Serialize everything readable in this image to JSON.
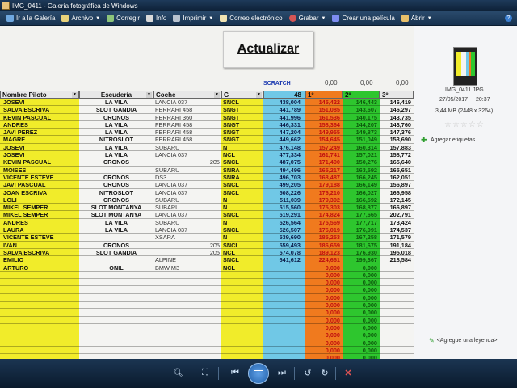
{
  "window": {
    "title": "IMG_0411 - Galería fotográfica de Windows"
  },
  "toolbar": {
    "items": [
      {
        "label": "Ir a la Galería",
        "icon": "back-icon",
        "dropdown": false
      },
      {
        "label": "Archivo",
        "icon": "file-icon",
        "dropdown": true
      },
      {
        "label": "Corregir",
        "icon": "fix-icon",
        "dropdown": false
      },
      {
        "label": "Info",
        "icon": "info-icon",
        "dropdown": false
      },
      {
        "label": "Imprimir",
        "icon": "print-icon",
        "dropdown": true
      },
      {
        "label": "Correo electrónico",
        "icon": "email-icon",
        "dropdown": false
      },
      {
        "label": "Grabar",
        "icon": "burn-icon",
        "dropdown": true
      },
      {
        "label": "Crear una película",
        "icon": "movie-icon",
        "dropdown": false
      },
      {
        "label": "Abrir",
        "icon": "open-icon",
        "dropdown": true
      }
    ]
  },
  "photo": {
    "button_label": "Actualizar",
    "scratch_label": "SCRATCH",
    "top_values": [
      "0,00",
      "0,00",
      "0,00"
    ],
    "headers": {
      "name": "Nombre Piloto",
      "team": "Escudería",
      "car": "Coche",
      "group": "G",
      "score": "48",
      "r1": "1º",
      "r2": "2º",
      "r3": "3º"
    },
    "rows": [
      {
        "name": "JOSEVI",
        "team": "LA VILA",
        "car": "LANCIA 037",
        "g": "SNCL",
        "score": "438,004",
        "r1": "145,422",
        "r2": "146,443",
        "r3": "146,419"
      },
      {
        "name": "SALVA ESCRIVA",
        "team": "SLOT GANDIA",
        "car": "FERRARI 458",
        "g": "SNGT",
        "score": "441,789",
        "r1": "151,085",
        "r2": "143,607",
        "r3": "146,297"
      },
      {
        "name": "KEVIN PASCUAL",
        "team": "CRONOS",
        "car": "FERRARI 360",
        "g": "SNGT",
        "score": "441,996",
        "r1": "161,536",
        "r2": "140,175",
        "r3": "143,735"
      },
      {
        "name": "ANDRES",
        "team": "LA VILA",
        "car": "FERRARI 458",
        "g": "SNGT",
        "score": "446,331",
        "r1": "158,364",
        "r2": "144,207",
        "r3": "143,760"
      },
      {
        "name": "JAVI PEREZ",
        "team": "LA VILA",
        "car": "FERRARI 458",
        "g": "SNGT",
        "score": "447,204",
        "r1": "149,955",
        "r2": "149,873",
        "r3": "147,376"
      },
      {
        "name": "MAGRE",
        "team": "NITROSLOT",
        "car": "FERRARI 458",
        "g": "SNGT",
        "score": "449,662",
        "r1": "154,645",
        "r2": "151,049",
        "r3": "153,690"
      },
      {
        "name": "JOSEVI",
        "team": "LA VILA",
        "car": "SUBARU",
        "g": "N",
        "score": "476,148",
        "r1": "157,249",
        "r2": "160,314",
        "r3": "157,883"
      },
      {
        "name": "JOSEVI",
        "team": "LA VILA",
        "car": "LANCIA 037",
        "g": "NCL",
        "score": "477,334",
        "r1": "161,741",
        "r2": "157,021",
        "r3": "158,772"
      },
      {
        "name": "KEVIN PASCUAL",
        "team": "CRONOS",
        "car": "205",
        "g": "SNCL",
        "score": "487,075",
        "r1": "171,400",
        "r2": "150,276",
        "r3": "165,640"
      },
      {
        "name": "MOISES",
        "team": "",
        "car": "SUBARU",
        "g": "SNRA",
        "score": "494,496",
        "r1": "165,217",
        "r2": "163,592",
        "r3": "165,651"
      },
      {
        "name": "VICENTE ESTEVE",
        "team": "CRONOS",
        "car": "DS3",
        "g": "SNRA",
        "score": "496,703",
        "r1": "168,487",
        "r2": "166,245",
        "r3": "162,051"
      },
      {
        "name": "JAVI PASCUAL",
        "team": "CRONOS",
        "car": "LANCIA 037",
        "g": "SNCL",
        "score": "499,205",
        "r1": "179,188",
        "r2": "166,149",
        "r3": "156,897"
      },
      {
        "name": "JOAN ESCRIVA",
        "team": "NITROSLOT",
        "car": "LANCIA 037",
        "g": "SNCL",
        "score": "508,226",
        "r1": "176,210",
        "r2": "166,027",
        "r3": "166,958"
      },
      {
        "name": "LOLI",
        "team": "CRONOS",
        "car": "SUBARU",
        "g": "N",
        "score": "511,039",
        "r1": "179,302",
        "r2": "166,592",
        "r3": "172,145"
      },
      {
        "name": "MIKEL SEMPER",
        "team": "SLOT MONTANYA",
        "car": "SUBARU",
        "g": "N",
        "score": "515,560",
        "r1": "175,303",
        "r2": "168,877",
        "r3": "166,897"
      },
      {
        "name": "MIKEL SEMPER",
        "team": "SLOT MONTANYA",
        "car": "LANCIA 037",
        "g": "SNCL",
        "score": "519,291",
        "r1": "174,824",
        "r2": "177,665",
        "r3": "202,791"
      },
      {
        "name": "ANDRES",
        "team": "LA VILA",
        "car": "SUBARU",
        "g": "N",
        "score": "526,564",
        "r1": "175,569",
        "r2": "177,717",
        "r3": "173,424"
      },
      {
        "name": "LAURA",
        "team": "LA VILA",
        "car": "LANCIA 037",
        "g": "SNCL",
        "score": "526,507",
        "r1": "176,019",
        "r2": "176,091",
        "r3": "174,537"
      },
      {
        "name": "VICENTE ESTEVE",
        "team": "",
        "car": "XSARA",
        "g": "N",
        "score": "539,690",
        "r1": "185,253",
        "r2": "167,258",
        "r3": "171,579"
      },
      {
        "name": "IVAN",
        "team": "CRONOS",
        "car": "205",
        "g": "SNCL",
        "score": "559,493",
        "r1": "186,659",
        "r2": "181,675",
        "r3": "191,184"
      },
      {
        "name": "SALVA ESCRIVA",
        "team": "SLOT GANDIA",
        "car": "205",
        "g": "NCL",
        "score": "574,078",
        "r1": "189,123",
        "r2": "176,930",
        "r3": "195,018"
      },
      {
        "name": "EMILIO",
        "team": "",
        "car": "ALPINE",
        "g": "SNCL",
        "score": "641,612",
        "r1": "224,661",
        "r2": "199,367",
        "r3": "218,584"
      },
      {
        "name": "ARTURO",
        "team": "ONIL",
        "car": "BMW M3",
        "g": "NCL",
        "score": "",
        "r1": "0,000",
        "r2": "0,000",
        "r3": ""
      },
      {
        "name": "",
        "team": "",
        "car": "",
        "g": "",
        "score": "",
        "r1": "0,000",
        "r2": "0,000",
        "r3": ""
      },
      {
        "name": "",
        "team": "",
        "car": "",
        "g": "",
        "score": "",
        "r1": "0,000",
        "r2": "0,000",
        "r3": ""
      },
      {
        "name": "",
        "team": "",
        "car": "",
        "g": "",
        "score": "",
        "r1": "0,000",
        "r2": "0,000",
        "r3": ""
      },
      {
        "name": "",
        "team": "",
        "car": "",
        "g": "",
        "score": "",
        "r1": "0,000",
        "r2": "0,000",
        "r3": ""
      },
      {
        "name": "",
        "team": "",
        "car": "",
        "g": "",
        "score": "",
        "r1": "0,000",
        "r2": "0,000",
        "r3": ""
      },
      {
        "name": "",
        "team": "",
        "car": "",
        "g": "",
        "score": "",
        "r1": "0,000",
        "r2": "0,000",
        "r3": ""
      },
      {
        "name": "",
        "team": "",
        "car": "",
        "g": "",
        "score": "",
        "r1": "0,000",
        "r2": "0,000",
        "r3": ""
      },
      {
        "name": "",
        "team": "",
        "car": "",
        "g": "",
        "score": "",
        "r1": "0,000",
        "r2": "0,000",
        "r3": ""
      },
      {
        "name": "",
        "team": "",
        "car": "",
        "g": "",
        "score": "",
        "r1": "0,000",
        "r2": "0,000",
        "r3": ""
      },
      {
        "name": "",
        "team": "",
        "car": "",
        "g": "",
        "score": "",
        "r1": "0,000",
        "r2": "0,000",
        "r3": ""
      },
      {
        "name": "",
        "team": "",
        "car": "",
        "g": "",
        "score": "",
        "r1": "0,000",
        "r2": "0,000",
        "r3": ""
      },
      {
        "name": "",
        "team": "",
        "car": "",
        "g": "",
        "score": "",
        "r1": "0,000",
        "r2": "0,000",
        "r3": ""
      }
    ]
  },
  "info_pane": {
    "filename": "IMG_0411.JPG",
    "date": "27/05/2017",
    "time": "20:37",
    "size": "3,44 MB (2448 x 3264)",
    "rating_stars": 0,
    "add_tags": "Agregar etiquetas",
    "add_caption": "<Agregue una leyenda>"
  },
  "colors": {
    "name_col": "#f1ec2a",
    "score_col": "#70c8e6",
    "round1_col": "#f07a1e",
    "round2_col": "#2ec62e",
    "toolbar": "#1f3c5e"
  }
}
